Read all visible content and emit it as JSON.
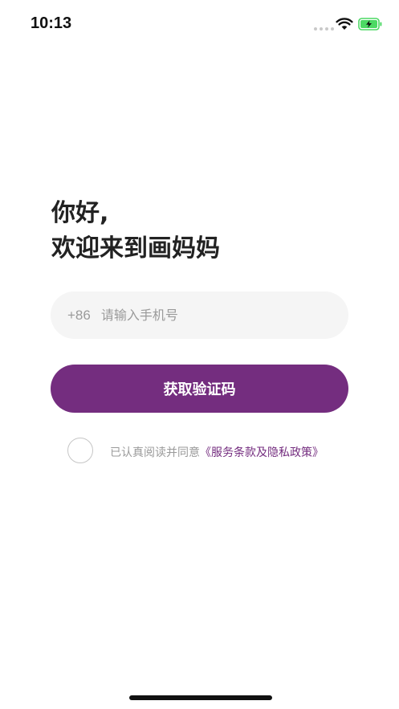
{
  "status_bar": {
    "time": "10:13",
    "battery_color": "#4cd964"
  },
  "greeting": {
    "line1": "你好,",
    "line2": "欢迎来到画妈妈"
  },
  "phone": {
    "country_code": "+86",
    "placeholder": "请输入手机号",
    "value": ""
  },
  "verify_button": {
    "label": "获取验证码"
  },
  "agreement": {
    "checked": false,
    "prefix": "已认真阅读并同意",
    "link_text": "《服务条款及隐私政策》"
  },
  "colors": {
    "accent": "#742d7f",
    "input_bg": "#f5f5f5",
    "muted_text": "#9a9a9a"
  }
}
